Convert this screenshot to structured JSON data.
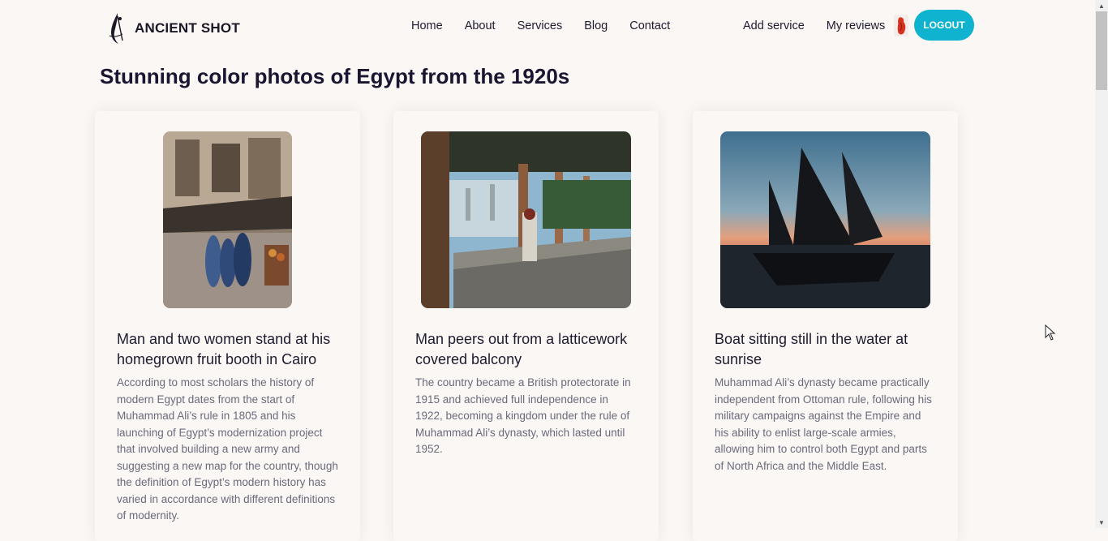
{
  "brand": {
    "name": "ANCIENT SHOT"
  },
  "nav": {
    "links": [
      "Home",
      "About",
      "Services",
      "Blog",
      "Contact"
    ],
    "user_links": [
      "Add service",
      "My reviews"
    ],
    "logout_label": "LOGOUT"
  },
  "page": {
    "title": "Stunning color photos of Egypt from the 1920s"
  },
  "cards": [
    {
      "title": "Man and two women stand at his homegrown fruit booth in Cairo",
      "text": "According to most scholars the history of modern Egypt dates from the start of Muhammad Ali’s rule in 1805 and his launching of Egypt’s modernization project that involved building a new army and suggesting a new map for the country, though the definition of Egypt’s modern history has varied in accordance with different definitions of modernity."
    },
    {
      "title": "Man peers out from a latticework covered balcony",
      "text": "The country became a British protectorate in 1915 and achieved full independence in 1922, becoming a kingdom under the rule of Muhammad Ali’s dynasty, which lasted until 1952."
    },
    {
      "title": "Boat sitting still in the water at sunrise",
      "text": "Muhammad Ali’s dynasty became practically independent from Ottoman rule, following his military campaigns against the Empire and his ability to enlist large-scale armies, allowing him to control both Egypt and parts of North Africa and the Middle East."
    }
  ],
  "colors": {
    "accent": "#0fb3cf",
    "background": "#faf7f5",
    "title": "#1b1531",
    "body_text": "#6b6a7a"
  }
}
